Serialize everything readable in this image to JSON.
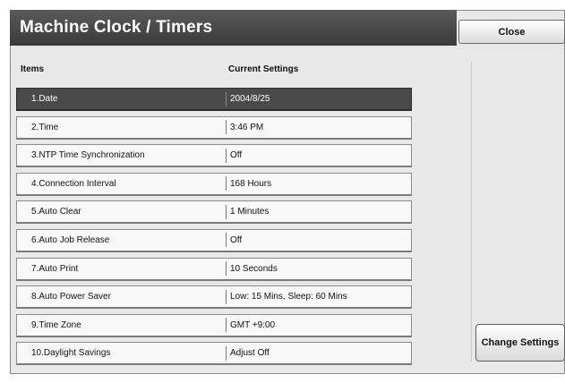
{
  "window": {
    "title": "Machine Clock / Timers",
    "close_label": "Close"
  },
  "table": {
    "headers": {
      "items": "Items",
      "current": "Current Settings"
    },
    "rows": [
      {
        "item": "1.Date",
        "value": "2004/8/25",
        "selected": true
      },
      {
        "item": "2.Time",
        "value": "3:46 PM",
        "selected": false
      },
      {
        "item": "3.NTP Time Synchronization",
        "value": "Off",
        "selected": false
      },
      {
        "item": "4.Connection Interval",
        "value": "168 Hours",
        "selected": false
      },
      {
        "item": "5.Auto Clear",
        "value": "1 Minutes",
        "selected": false
      },
      {
        "item": "6.Auto Job Release",
        "value": "Off",
        "selected": false
      },
      {
        "item": "7.Auto Print",
        "value": "10 Seconds",
        "selected": false
      },
      {
        "item": "8.Auto Power Saver",
        "value": "Low: 15 Mins,  Sleep: 60 Mins",
        "selected": false
      },
      {
        "item": "9.Time Zone",
        "value": "GMT +9:00",
        "selected": false
      },
      {
        "item": "10.Daylight Savings",
        "value": "Adjust Off",
        "selected": false
      }
    ]
  },
  "actions": {
    "change_settings_label": "Change Settings"
  },
  "colors": {
    "title_bar": "#4a4a4a",
    "selected_row": "#4a4a4a",
    "panel_bg": "#e8e8e8"
  }
}
